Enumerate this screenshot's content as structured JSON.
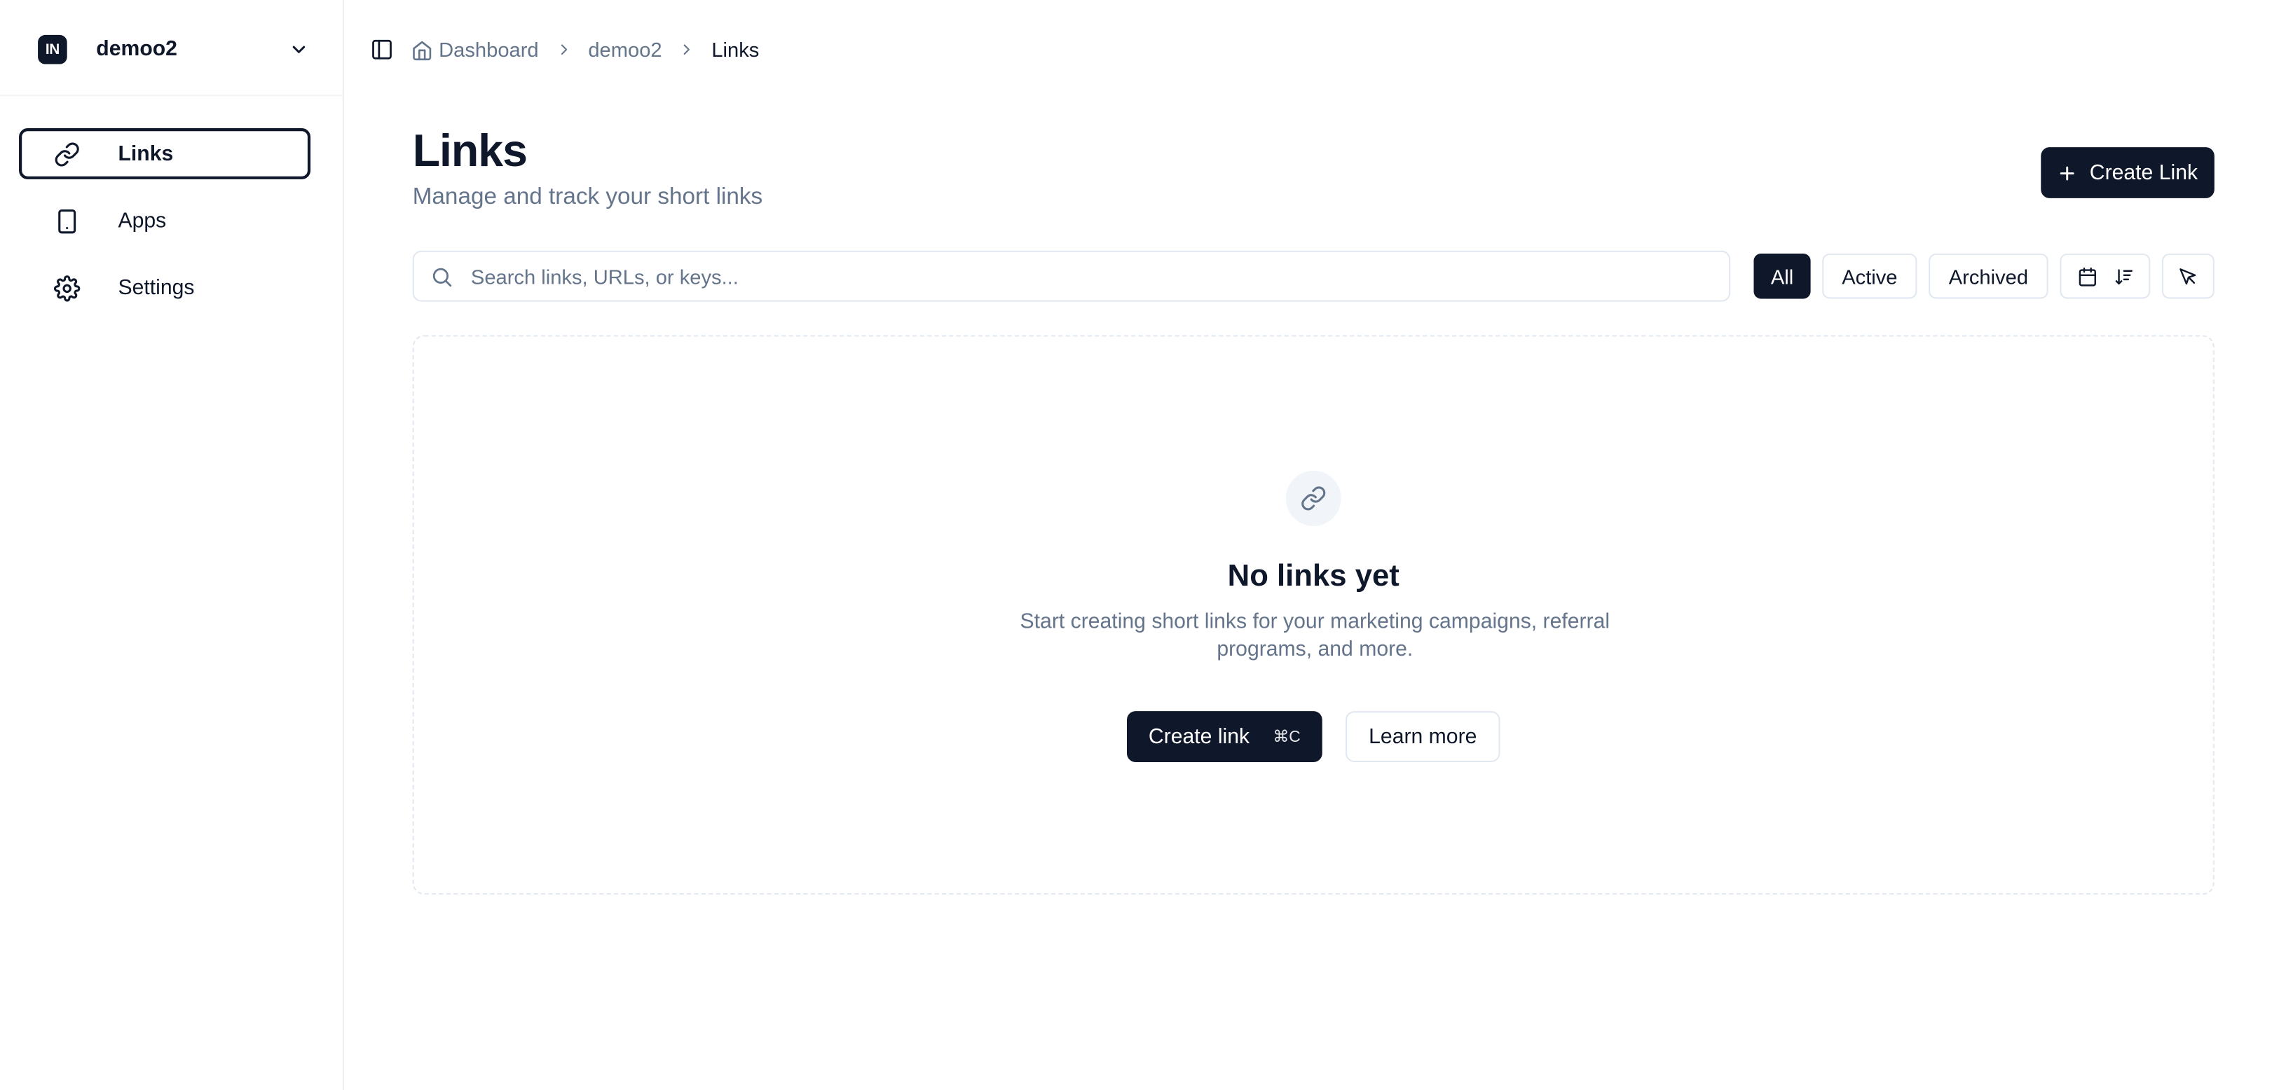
{
  "workspace": {
    "logo_text": "IN",
    "name": "demoo2"
  },
  "sidebar": {
    "items": [
      {
        "label": "Links",
        "icon": "link-icon",
        "active": true
      },
      {
        "label": "Apps",
        "icon": "tablet-icon",
        "active": false
      },
      {
        "label": "Settings",
        "icon": "gear-icon",
        "active": false
      }
    ]
  },
  "breadcrumb": [
    "Dashboard",
    "demoo2",
    "Links"
  ],
  "header": {
    "title": "Links",
    "subtitle": "Manage and track your short links",
    "create_button": "Create Link"
  },
  "search": {
    "placeholder": "Search links, URLs, or keys...",
    "value": ""
  },
  "filters": [
    "All",
    "Active",
    "Archived"
  ],
  "selected_filter": "All",
  "empty_state": {
    "title": "No links yet",
    "description": "Start creating short links for your marketing campaigns, referral programs, and more.",
    "create_button": "Create link",
    "shortcut": "⌘C",
    "learn_button": "Learn more"
  },
  "colors": {
    "primary": "#0f172a",
    "muted_text": "#64748b",
    "border": "#e2e8f0",
    "icon_bg": "#f1f5f9"
  }
}
